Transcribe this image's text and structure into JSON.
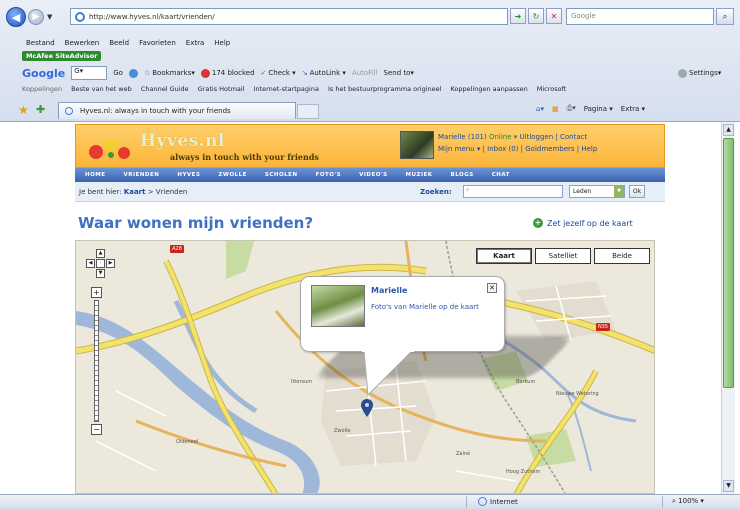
{
  "browser": {
    "address_url": "http://www.hyves.nl/kaart/vrienden/",
    "search_placeholder": "Google",
    "menu": [
      "Bestand",
      "Bewerken",
      "Beeld",
      "Favorieten",
      "Extra",
      "Help"
    ],
    "mcafee_label": "McAfee SiteAdvisor",
    "google_toolbar": {
      "logo": "Google",
      "go_label": "Go",
      "items": [
        "Bookmarks▾",
        "174 blocked",
        "Check ▾",
        "AutoLink ▾",
        "AutoFill",
        "Send to▾"
      ],
      "settings": "Settings▾"
    },
    "links_bar": [
      "Koppelingen",
      "Beste van het web",
      "Channel Guide",
      "Gratis Hotmail",
      "Internet-startpagina",
      "Is het bestuurprogramma origineel",
      "Koppelingen aanpassen",
      "Microsoft"
    ],
    "tab_title": "Hyves.nl: always in touch with your friends",
    "cmd_items": [
      "Pagina ▾",
      "Extra ▾"
    ]
  },
  "site": {
    "logo_text": "Hyves.nl",
    "tagline": "always in touch with your friends",
    "user": {
      "line1_name": "Marielle (101)",
      "line1_status": "Online ▾",
      "line1_links": "Uitloggen | Contact",
      "line2": "Mijn menu ▾ | Inbox (0) | Goldmembers | Help"
    },
    "nav": [
      "HOME",
      "VRIENDEN",
      "HYVES",
      "ZWOLLE",
      "SCHOLEN",
      "FOTO'S",
      "VIDEO'S",
      "MUZIEK",
      "BLOGS",
      "CHAT"
    ],
    "breadcrumb_prefix": "Je bent hier:",
    "breadcrumb_link": "Kaart",
    "breadcrumb_current": "> Vrienden",
    "search": {
      "label": "Zoeken:",
      "placeholder": "",
      "select_value": "Leden",
      "ok_label": "Ok"
    },
    "page_title": "Waar wonen mijn vrienden?",
    "zet_link": "Zet jezelf op de kaart",
    "map": {
      "type_buttons": [
        "Kaart",
        "Satelliet",
        "Beide"
      ],
      "active_type": "Kaart",
      "bubble_name": "Marielle",
      "bubble_link": "Foto's van Marielle op de kaart",
      "labels": [
        "Zwolle",
        "Ittersum",
        "Zalné",
        "Hoog Zuthem",
        "Nieuwe Wetering",
        "Oldeneel",
        "Berkum"
      ],
      "road_badges": [
        "A28",
        "N35"
      ]
    }
  },
  "statusbar": {
    "zone": "Internet",
    "zoom": "100%"
  },
  "colors": {
    "hyves_orange": "#fbb43a",
    "hyves_blue": "#3f72c2",
    "map_bg": "#ece8dc",
    "road_yellow": "#f4e36b",
    "water": "#9fb7d9",
    "park": "#c7dca3"
  }
}
